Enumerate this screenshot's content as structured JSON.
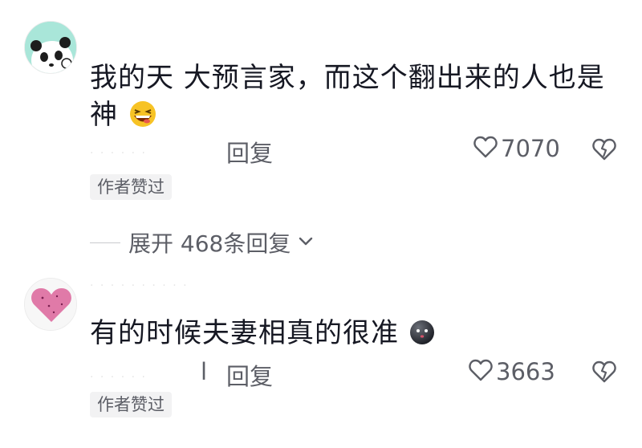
{
  "comments": [
    {
      "text": "我的天 大预言家，而这个翻出来的人也是",
      "text_line2": "神",
      "emoji": "grinning-squint-emoji",
      "reply_label": "回复",
      "likes": "7070",
      "author_badge": "作者赞过",
      "avatar": "panda-avatar",
      "expand_replies": "展开 468条回复"
    },
    {
      "text": "有的时候夫妻相真的很准",
      "emoji": "dark-face-emoji",
      "reply_prefix": "l",
      "reply_label": "回复",
      "likes": "3663",
      "author_badge": "作者赞过",
      "avatar": "pink-heart-avatar"
    }
  ],
  "colors": {
    "text": "#161823",
    "meta": "#5c5e66",
    "badge_bg": "#f2f2f3",
    "avatar1_bg": "#a9e6d9",
    "avatar2_heart": "#e07aa8"
  }
}
